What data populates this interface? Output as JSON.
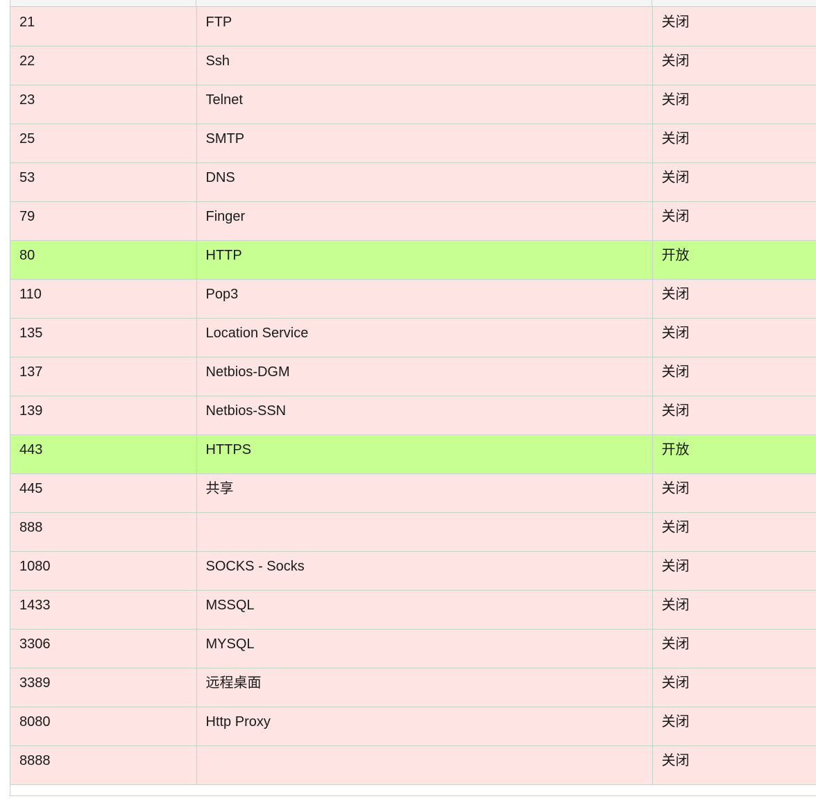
{
  "colors": {
    "closed_row": "#ffe4e4",
    "open_row": "#c8ff92",
    "border": "#c7d2c9"
  },
  "ports": [
    {
      "port": "21",
      "service": "FTP",
      "status": "关闭",
      "open": false
    },
    {
      "port": "22",
      "service": "Ssh",
      "status": "关闭",
      "open": false
    },
    {
      "port": "23",
      "service": "Telnet",
      "status": "关闭",
      "open": false
    },
    {
      "port": "25",
      "service": "SMTP",
      "status": "关闭",
      "open": false
    },
    {
      "port": "53",
      "service": "DNS",
      "status": "关闭",
      "open": false
    },
    {
      "port": "79",
      "service": "Finger",
      "status": "关闭",
      "open": false
    },
    {
      "port": "80",
      "service": "HTTP",
      "status": "开放",
      "open": true
    },
    {
      "port": "110",
      "service": "Pop3",
      "status": "关闭",
      "open": false
    },
    {
      "port": "135",
      "service": "Location Service",
      "status": "关闭",
      "open": false
    },
    {
      "port": "137",
      "service": "Netbios-DGM",
      "status": "关闭",
      "open": false
    },
    {
      "port": "139",
      "service": "Netbios-SSN",
      "status": "关闭",
      "open": false
    },
    {
      "port": "443",
      "service": "HTTPS",
      "status": "开放",
      "open": true
    },
    {
      "port": "445",
      "service": "共享",
      "status": "关闭",
      "open": false
    },
    {
      "port": "888",
      "service": "",
      "status": "关闭",
      "open": false
    },
    {
      "port": "1080",
      "service": "SOCKS - Socks",
      "status": "关闭",
      "open": false
    },
    {
      "port": "1433",
      "service": "MSSQL",
      "status": "关闭",
      "open": false
    },
    {
      "port": "3306",
      "service": "MYSQL",
      "status": "关闭",
      "open": false
    },
    {
      "port": "3389",
      "service": "远程桌面",
      "status": "关闭",
      "open": false
    },
    {
      "port": "8080",
      "service": "Http Proxy",
      "status": "关闭",
      "open": false
    },
    {
      "port": "8888",
      "service": "",
      "status": "关闭",
      "open": false
    }
  ]
}
